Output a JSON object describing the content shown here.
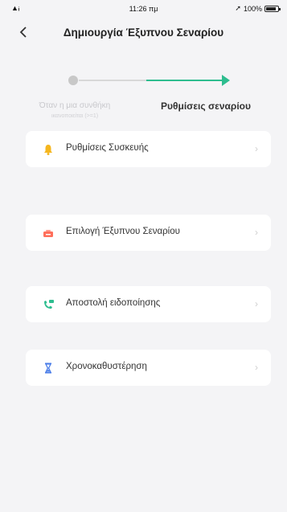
{
  "status_bar": {
    "time": "11:26 πμ",
    "battery": "100%"
  },
  "header": {
    "title": "Δημιουργία Έξυπνου Σεναρίου"
  },
  "stepper": {
    "step1_title": "Όταν η μια συνθήκη",
    "step1_sub": "ικανοποιείται (>=1)",
    "step2_title": "Ρυθμίσεις σεναρίου",
    "active_color": "#2ebd8f",
    "inactive_color": "#c8c8c8"
  },
  "options": [
    {
      "label": "Ρυθμίσεις Συσκευής",
      "icon": "bell-icon",
      "color": "#f5b61e"
    },
    {
      "label": "Επιλογή Έξυπνου Σεναρίου",
      "icon": "scene-icon",
      "color": "#ff6f5b"
    },
    {
      "label": "Αποστολή ειδοποίησης",
      "icon": "notification-icon",
      "color": "#2ebd8f"
    },
    {
      "label": "Χρονοκαθυστέρηση",
      "icon": "hourglass-icon",
      "color": "#4a7de8"
    }
  ]
}
